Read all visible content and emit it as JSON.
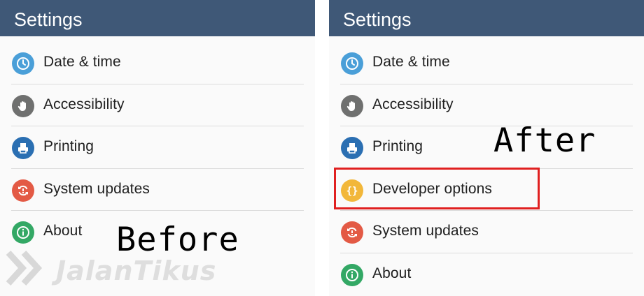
{
  "before": {
    "appbar_title": "Settings",
    "items": [
      {
        "label": "Date & time",
        "icon": "clock-icon",
        "color": "#4a9fd8"
      },
      {
        "label": "Accessibility",
        "icon": "hand-icon",
        "color": "#6f706f"
      },
      {
        "label": "Printing",
        "icon": "printer-icon",
        "color": "#2b6fb2"
      },
      {
        "label": "System updates",
        "icon": "refresh-icon",
        "color": "#e35a45"
      },
      {
        "label": "About",
        "icon": "info-icon",
        "color": "#33a865"
      }
    ],
    "caption": "Before"
  },
  "after": {
    "appbar_title": "Settings",
    "items": [
      {
        "label": "Date & time",
        "icon": "clock-icon",
        "color": "#4a9fd8"
      },
      {
        "label": "Accessibility",
        "icon": "hand-icon",
        "color": "#6f706f"
      },
      {
        "label": "Printing",
        "icon": "printer-icon",
        "color": "#2b6fb2"
      },
      {
        "label": "Developer options",
        "icon": "braces-icon",
        "color": "#f2b73a"
      },
      {
        "label": "System updates",
        "icon": "refresh-icon",
        "color": "#e35a45"
      },
      {
        "label": "About",
        "icon": "info-icon",
        "color": "#33a865"
      }
    ],
    "caption": "After"
  },
  "watermark_text": "JalanTikus",
  "colors": {
    "appbar": "#3f5877",
    "highlight": "#e02020"
  }
}
